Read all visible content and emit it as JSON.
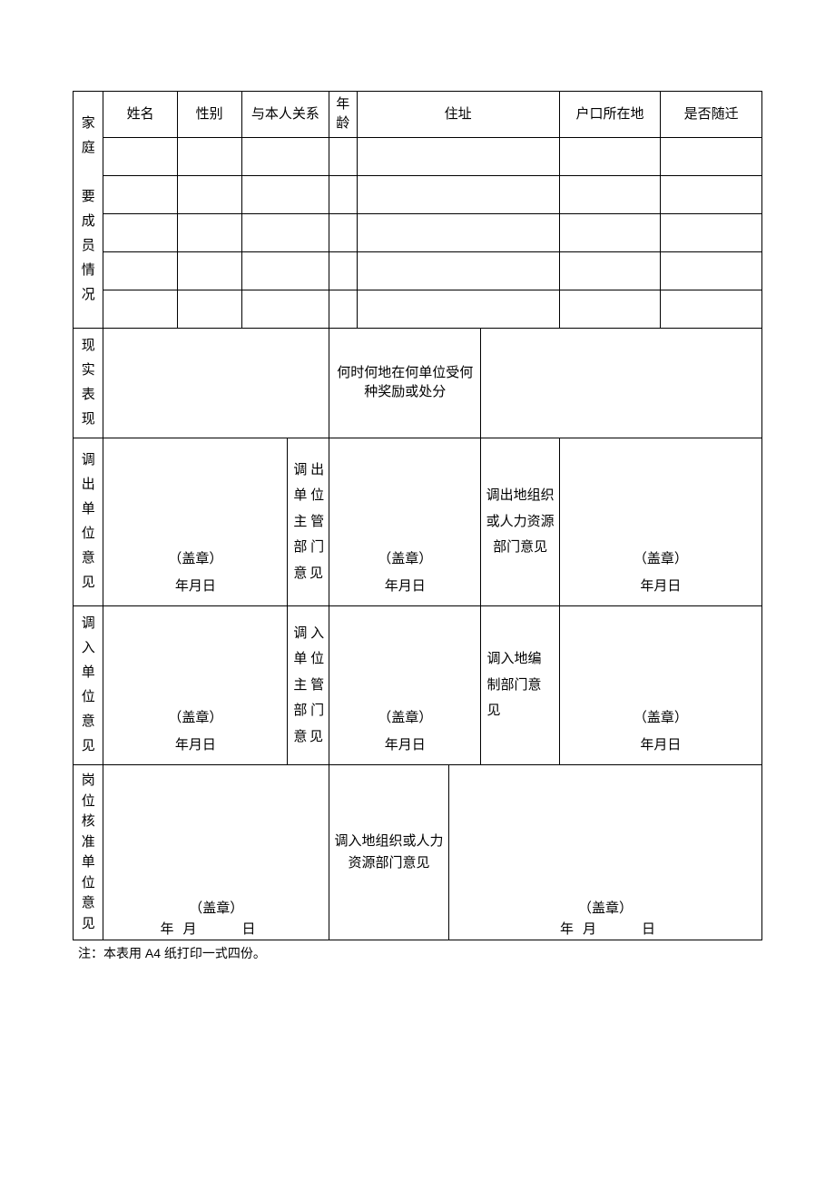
{
  "headers": {
    "name": "姓名",
    "gender": "性别",
    "relation": "与本人关系",
    "age": "年龄",
    "address": "住址",
    "hukou": "户口所在地",
    "migrate": "是否随迁"
  },
  "section_labels": {
    "family": "家庭要成员情况",
    "performance": "现实表现",
    "reward": "何时何地在何单位受何种奖励或处分",
    "out_unit": "调出单位意见",
    "out_mgr": "调出单位主管部门意见",
    "out_hr": "调出地组织或人力资源部门意见",
    "in_unit": "调入单位意见",
    "in_mgr": "调入单位主管部门意见",
    "in_staff": "调入地编制部门意见",
    "post_approve": "岗位核准单位意见",
    "in_hr": "调入地组织或人力资源部门意见"
  },
  "stamp": {
    "seal": "（盖章）",
    "ymd": "年月日",
    "y": "年",
    "m": "月",
    "d": "日"
  },
  "note_prefix": "注：本表用",
  "note_a4": " A4 ",
  "note_suffix": "纸打印一式四份。"
}
